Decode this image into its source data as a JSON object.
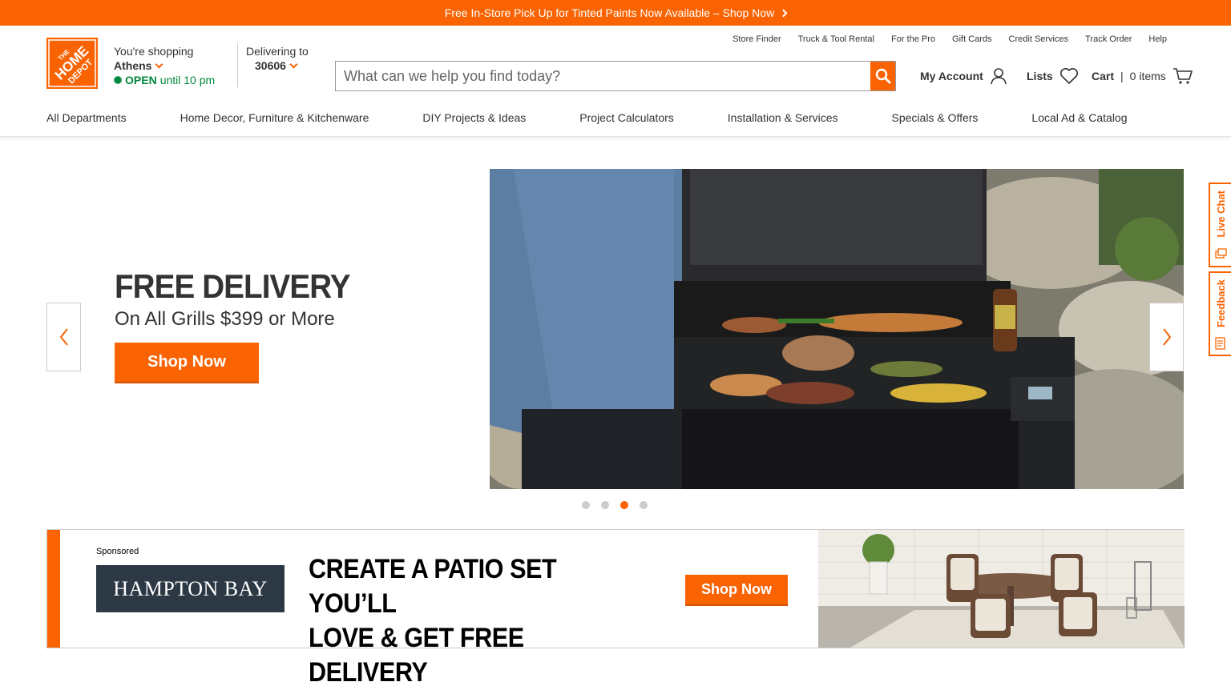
{
  "promo": {
    "text": "Free In-Store Pick Up for Tinted Paints Now Available – Shop Now"
  },
  "logo": {
    "text": "THE HOME DEPOT"
  },
  "store": {
    "shopping_label": "You're shopping",
    "city": "Athens",
    "status": "OPEN",
    "hours": "until 10 pm"
  },
  "delivery": {
    "label": "Delivering to",
    "zip": "30606"
  },
  "utility_links": [
    "Store Finder",
    "Truck & Tool Rental",
    "For the Pro",
    "Gift Cards",
    "Credit Services",
    "Track Order",
    "Help"
  ],
  "search": {
    "placeholder": "What can we help you find today?"
  },
  "account": {
    "my_account": "My Account",
    "lists": "Lists",
    "cart": "Cart",
    "cart_items": "0 items"
  },
  "nav": [
    "All Departments",
    "Home Decor, Furniture & Kitchenware",
    "DIY Projects & Ideas",
    "Project Calculators",
    "Installation & Services",
    "Specials & Offers",
    "Local Ad & Catalog"
  ],
  "hero": {
    "title": "FREE DELIVERY",
    "subtitle": "On All Grills $399 or More",
    "button": "Shop Now",
    "slides": 4,
    "active_slide": 3
  },
  "side_tabs": {
    "live_chat": "Live Chat",
    "feedback": "Feedback"
  },
  "banner": {
    "sponsored": "Sponsored",
    "brand": "HAMPTON BAY",
    "headline_1": "CREATE A PATIO SET YOU’LL",
    "headline_2": "LOVE & GET FREE DELIVERY",
    "button": "Shop Now"
  },
  "colors": {
    "brand_orange": "#f96302",
    "open_green": "#00873c",
    "text": "#333333"
  }
}
